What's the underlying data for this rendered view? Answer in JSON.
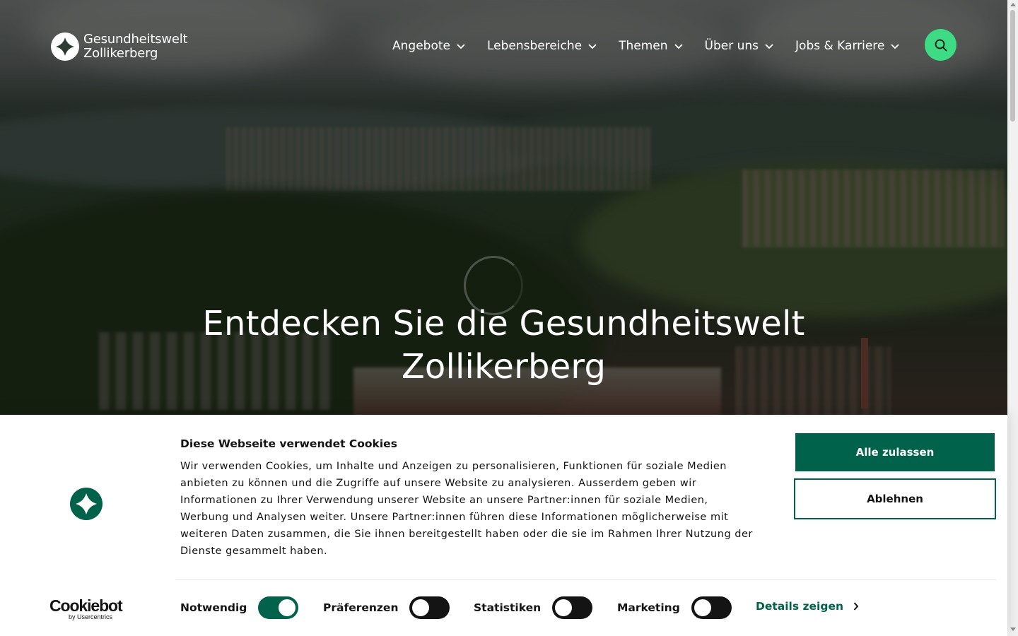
{
  "brand": {
    "name_line1": "Gesundheitswelt",
    "name_line2": "Zollikerberg"
  },
  "nav": {
    "items": [
      {
        "label": "Angebote"
      },
      {
        "label": "Lebensbereiche"
      },
      {
        "label": "Themen"
      },
      {
        "label": "Über uns"
      },
      {
        "label": "Jobs & Karriere"
      }
    ],
    "search_icon": "search-icon"
  },
  "hero": {
    "title_line1": "Entdecken Sie die Gesundheitswelt",
    "title_line2": "Zollikerberg"
  },
  "cookie": {
    "title": "Diese Webseite verwendet Cookies",
    "description": "Wir verwenden Cookies, um Inhalte und Anzeigen zu personalisieren, Funktionen für soziale Medien anbieten zu können und die Zugriffe auf unsere Website zu analysieren. Ausserdem geben wir Informationen zu Ihrer Verwendung unserer Website an unsere Partner:innen für soziale Medien, Werbung und Analysen weiter. Unsere Partner:innen führen diese Informationen möglicherweise mit weiteren Daten zusammen, die Sie ihnen bereitgestellt haben oder die sie im Rahmen Ihrer Nutzung der Dienste gesammelt haben.",
    "accept_label": "Alle zulassen",
    "decline_label": "Ablehnen",
    "toggles": [
      {
        "label": "Notwendig",
        "on": true
      },
      {
        "label": "Präferenzen",
        "on": false
      },
      {
        "label": "Statistiken",
        "on": false
      },
      {
        "label": "Marketing",
        "on": false
      }
    ],
    "details_label": "Details zeigen",
    "provider_main": "Cookiebot",
    "provider_sub": "by Usercentrics"
  },
  "colors": {
    "primary_green": "#00624a",
    "search_green": "#3ddc84",
    "text": "#141414"
  }
}
